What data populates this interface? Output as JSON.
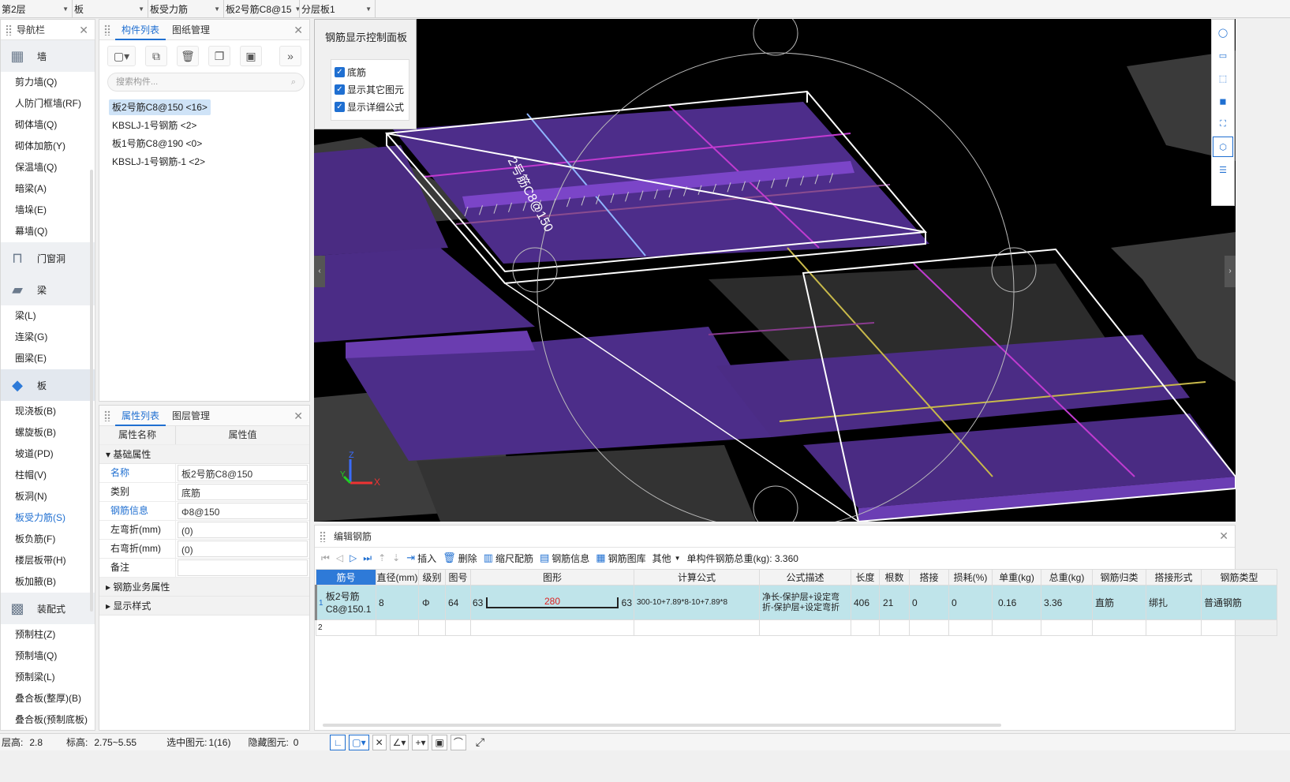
{
  "topbar": {
    "floor": "第2层",
    "type": "板",
    "subtype": "板受力筋",
    "component": "板2号筋C8@15",
    "layer": "分层板1"
  },
  "nav": {
    "title": "导航栏",
    "groups": [
      {
        "label": "墙",
        "icon": "wall-icon",
        "items": [
          "剪力墙(Q)",
          "人防门框墙(RF)",
          "砌体墙(Q)",
          "砌体加筋(Y)",
          "保温墙(Q)",
          "暗梁(A)",
          "墙垛(E)",
          "幕墙(Q)"
        ]
      },
      {
        "label": "门窗洞",
        "icon": "door-window-icon",
        "items": []
      },
      {
        "label": "梁",
        "icon": "beam-icon",
        "items": [
          "梁(L)",
          "连梁(G)",
          "圈梁(E)"
        ]
      },
      {
        "label": "板",
        "icon": "slab-icon",
        "items": [
          "现浇板(B)",
          "螺旋板(B)",
          "坡道(PD)",
          "柱帽(V)",
          "板洞(N)",
          "板受力筋(S)",
          "板负筋(F)",
          "楼层板带(H)",
          "板加腋(B)"
        ]
      },
      {
        "label": "装配式",
        "icon": "prefab-icon",
        "items": [
          "预制柱(Z)",
          "预制墙(Q)",
          "预制梁(L)",
          "叠合板(整厚)(B)",
          "叠合板(预制底板)"
        ]
      }
    ],
    "selected": "板受力筋(S)"
  },
  "components": {
    "tabs": [
      "构件列表",
      "图纸管理"
    ],
    "search_placeholder": "搜索构件...",
    "items": [
      "板2号筋C8@150 <16>",
      "KBSLJ-1号钢筋 <2>",
      "板1号筋C8@190 <0>",
      "KBSLJ-1号钢筋-1 <2>"
    ]
  },
  "props": {
    "tabs": [
      "属性列表",
      "图层管理"
    ],
    "headers": [
      "属性名称",
      "属性值"
    ],
    "section_basic": "基础属性",
    "rows": [
      {
        "name": "名称",
        "value": "板2号筋C8@150",
        "blue": true
      },
      {
        "name": "类别",
        "value": "底筋",
        "blue": false
      },
      {
        "name": "钢筋信息",
        "value": "Φ8@150",
        "blue": true
      },
      {
        "name": "左弯折(mm)",
        "value": "(0)",
        "blue": false
      },
      {
        "name": "右弯折(mm)",
        "value": "(0)",
        "blue": false
      },
      {
        "name": "备注",
        "value": "",
        "blue": false
      }
    ],
    "section_business": "钢筋业务属性",
    "section_style": "显示样式"
  },
  "control_panel": {
    "title": "钢筋显示控制面板",
    "options": [
      "底筋",
      "显示其它图元",
      "显示详细公式"
    ]
  },
  "viewport": {
    "rebar_label": "2号筋C8@150",
    "dim_left": "63",
    "dim_mid": "280",
    "axis_x": "X",
    "axis_y": "Y",
    "axis_z": "Z"
  },
  "editor": {
    "title": "编辑钢筋",
    "buttons": [
      "插入",
      "删除",
      "缩尺配筋",
      "钢筋信息",
      "钢筋图库",
      "其他"
    ],
    "total_label": "单构件钢筋总重(kg): 3.360",
    "headers": [
      "筋号",
      "直径(mm)",
      "级别",
      "图号",
      "图形",
      "计算公式",
      "公式描述",
      "长度",
      "根数",
      "搭接",
      "损耗(%)",
      "单重(kg)",
      "总重(kg)",
      "钢筋归类",
      "搭接形式",
      "钢筋类型"
    ],
    "row": {
      "idx": "1",
      "name1": "板2号筋",
      "name2": "C8@150.1",
      "diameter": "8",
      "grade": "Φ",
      "fig": "64",
      "left": "63",
      "shape": "280",
      "right": "63",
      "formula": "300-10+7.89*8-10+7.89*8",
      "desc1": "净长-保护层+设定弯",
      "desc2": "折-保护层+设定弯折",
      "length": "406",
      "count": "21",
      "lap": "0",
      "loss": "0",
      "unit": "0.16",
      "total": "3.36",
      "class": "直筋",
      "lapform": "绑扎",
      "type": "普通钢筋"
    },
    "row2_idx": "2"
  },
  "status": {
    "floor_h_label": "层高:",
    "floor_h": "2.8",
    "elev_label": "标高:",
    "elev": "2.75~5.55",
    "sel_label": "选中图元:",
    "sel": "1(16)",
    "hid_label": "隐藏图元:",
    "hid": "0"
  }
}
